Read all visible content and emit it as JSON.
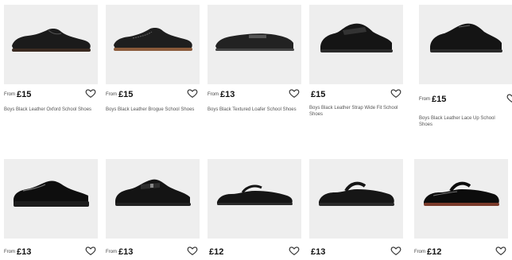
{
  "products": [
    {
      "from": "From",
      "price": "£15",
      "name": "Boys Black Leather Oxford School Shoes",
      "style": "oxford"
    },
    {
      "from": "From",
      "price": "£15",
      "name": "Boys Black Leather Brogue School Shoes",
      "style": "brogue"
    },
    {
      "from": "From",
      "price": "£13",
      "name": "Boys Black Textured Loafer School Shoes",
      "style": "loafer"
    },
    {
      "from": "",
      "price": "£15",
      "name": "Boys Black Leather Strap Wide Fit School Shoes",
      "style": "strap"
    },
    {
      "from": "From",
      "price": "£15",
      "name": "Boys Black Leather Lace Up School Shoes",
      "style": "laceup"
    },
    {
      "from": "From",
      "price": "£13",
      "name": "",
      "style": "patent-oxford"
    },
    {
      "from": "From",
      "price": "£13",
      "name": "",
      "style": "buckle"
    },
    {
      "from": "",
      "price": "£12",
      "name": "",
      "style": "maryjane"
    },
    {
      "from": "",
      "price": "£13",
      "name": "",
      "style": "maryjane2"
    },
    {
      "from": "From",
      "price": "£12",
      "name": "",
      "style": "patent-maryjane"
    }
  ]
}
